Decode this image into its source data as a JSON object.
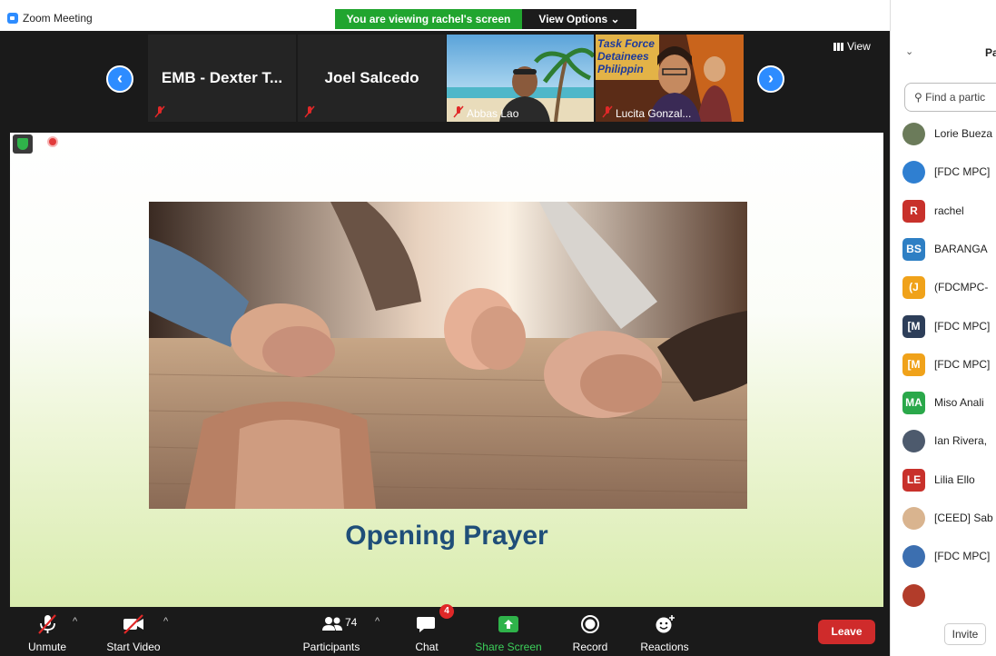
{
  "window": {
    "title": "Zoom Meeting"
  },
  "banner": {
    "viewing": "You are viewing rachel's screen",
    "view_options": "View Options ⌄"
  },
  "gallery": {
    "view_label": "View",
    "tiles": [
      {
        "name": "EMB - Dexter T..."
      },
      {
        "name": "Joel Salcedo"
      },
      {
        "name": "Abbas Lao"
      },
      {
        "name": "Lucita Gonzal...",
        "sign_text": "Task Force Detainees Philippin"
      }
    ]
  },
  "slide": {
    "title": "Opening Prayer"
  },
  "toolbar": {
    "unmute": "Unmute",
    "start_video": "Start Video",
    "participants": "Participants",
    "participants_count": "74",
    "chat": "Chat",
    "chat_badge": "4",
    "share_screen": "Share Screen",
    "record": "Record",
    "reactions": "Reactions",
    "leave": "Leave"
  },
  "panel": {
    "title": "Pa",
    "search_placeholder": "Find a partic",
    "invite": "Invite",
    "participants": [
      {
        "name": "Lorie Bueza",
        "initials": "",
        "color": "#6b7b5a"
      },
      {
        "name": "[FDC MPC]",
        "initials": "",
        "color": "#2f7fd1"
      },
      {
        "name": "rachel",
        "initials": "R",
        "color": "#c8312b"
      },
      {
        "name": "BARANGA",
        "initials": "BS",
        "color": "#2e7fc4"
      },
      {
        "name": "(FDCMPC-",
        "initials": "(J",
        "color": "#f0a21a"
      },
      {
        "name": "[FDC MPC]",
        "initials": "[M",
        "color": "#2d3e59"
      },
      {
        "name": "[FDC MPC]",
        "initials": "[M",
        "color": "#f0a21a"
      },
      {
        "name": "Miso Anali",
        "initials": "MA",
        "color": "#2aa84a"
      },
      {
        "name": "Ian Rivera,",
        "initials": "",
        "color": "#4d5a6d"
      },
      {
        "name": "Lilia Ello",
        "initials": "LE",
        "color": "#c8312b"
      },
      {
        "name": "[CEED] Sab",
        "initials": "",
        "color": "#d9b48f"
      },
      {
        "name": "[FDC MPC]",
        "initials": "",
        "color": "#3c6fb0"
      },
      {
        "name": "",
        "initials": "",
        "color": "#b23c2a"
      }
    ]
  }
}
